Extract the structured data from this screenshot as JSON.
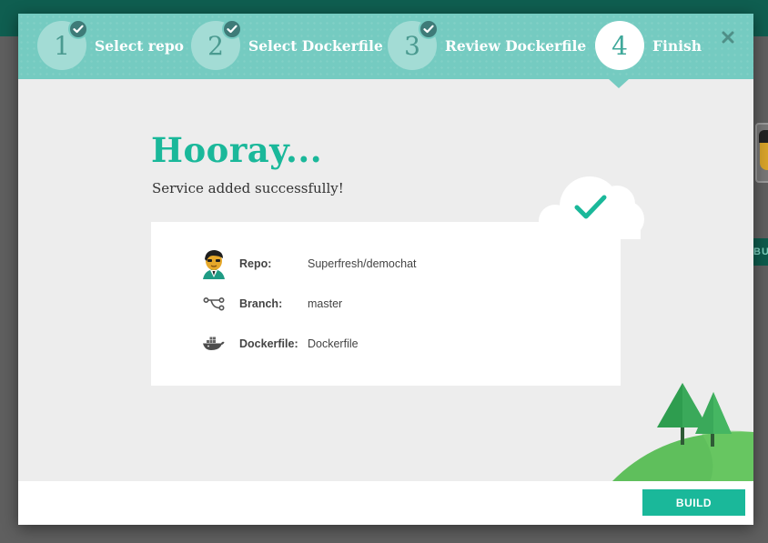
{
  "background": {
    "side_button_label": "BUILD"
  },
  "wizard": {
    "steps": [
      {
        "number": "1",
        "label": "Select repo",
        "completed": true
      },
      {
        "number": "2",
        "label": "Select Dockerfile",
        "completed": true
      },
      {
        "number": "3",
        "label": "Review Dockerfile",
        "completed": true
      },
      {
        "number": "4",
        "label": "Finish",
        "completed": false,
        "active": true
      }
    ],
    "close_icon": "close-icon",
    "check_icon": "check-icon"
  },
  "main": {
    "headline": "Hooray...",
    "subline": "Service added successfully!",
    "success_icon": "cloud-check-icon",
    "details": [
      {
        "icon": "repo-avatar-icon",
        "key": "Repo:",
        "value": "Superfresh/demochat"
      },
      {
        "icon": "branch-icon",
        "key": "Branch:",
        "value": "master"
      },
      {
        "icon": "docker-whale-icon",
        "key": "Dockerfile:",
        "value": "Dockerfile"
      }
    ]
  },
  "footer": {
    "build_label": "BUILD"
  },
  "colors": {
    "accent": "#1ab89a",
    "header": "#75cbc1",
    "topbar": "#0f5e50"
  }
}
